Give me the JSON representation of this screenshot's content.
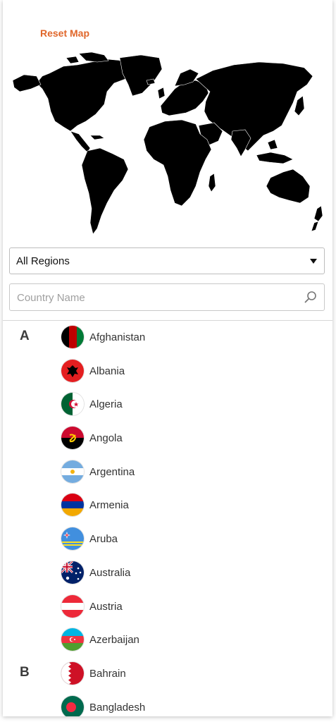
{
  "header": {
    "reset_label": "Reset Map"
  },
  "filters": {
    "region_selected": "All Regions",
    "search_placeholder": "Country Name"
  },
  "groups": [
    {
      "letter": "A",
      "countries": [
        "Afghanistan",
        "Albania",
        "Algeria",
        "Angola",
        "Argentina",
        "Armenia",
        "Aruba",
        "Australia",
        "Austria",
        "Azerbaijan"
      ]
    },
    {
      "letter": "B",
      "countries": [
        "Bahrain",
        "Bangladesh"
      ]
    }
  ],
  "colors": {
    "accent": "#e0662a",
    "map_fill": "#000000"
  }
}
